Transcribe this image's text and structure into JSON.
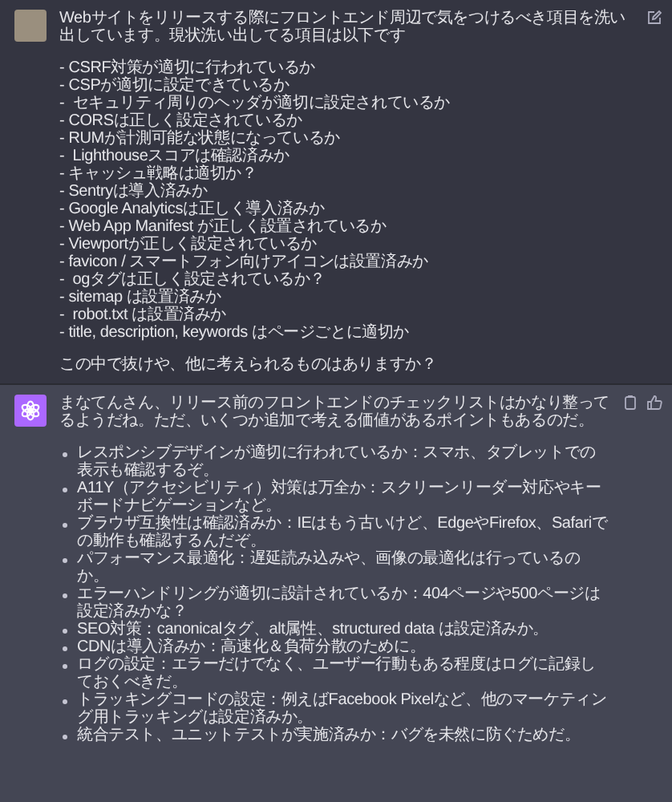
{
  "messages": [
    {
      "kind": "user",
      "text": "Webサイトをリリースする際にフロントエンド周辺で気をつけるべき項目を洗い出しています。現状洗い出してる項目は以下です",
      "list": [
        "- CSRF対策が適切に行われているか",
        "- CSPが適切に設定できているか",
        "-  セキュリティ周りのヘッダが適切に設定されているか",
        "- CORSは正しく設定されているか",
        "- RUMが計測可能な状態になっているか",
        "-  Lighthouseスコアは確認済みか",
        "- キャッシュ戦略は適切か？",
        "- Sentryは導入済みか",
        "- Google Analyticsは正しく導入済みか",
        "- Web App Manifest が正しく設置されているか",
        "- Viewportが正しく設定されているか",
        "- favicon / スマートフォン向けアイコンは設置済みか",
        "-  ogタグは正しく設定されているか？",
        "- sitemap は設置済みか",
        "-  robot.txt は設置済みか",
        "- title, description, keywords はページごとに適切か"
      ],
      "outro": "この中で抜けや、他に考えられるものはありますか？"
    },
    {
      "kind": "assistant",
      "text": "まなてんさん、リリース前のフロントエンドのチェックリストはかなり整ってるようだね。ただ、いくつか追加で考える価値があるポイントもあるのだ。",
      "list": [
        "レスポンシブデザインが適切に行われているか：スマホ、タブレットでの表示も確認するぞ。",
        "A11Y（アクセシビリティ）対策は万全か：スクリーンリーダー対応やキーボードナビゲーションなど。",
        "ブラウザ互換性は確認済みか：IEはもう古いけど、EdgeやFirefox、Safariでの動作も確認するんだぞ。",
        "パフォーマンス最適化：遅延読み込みや、画像の最適化は行っているのか。",
        "エラーハンドリングが適切に設計されているか：404ページや500ページは設定済みかな？",
        "SEO対策：canonicalタグ、alt属性、structured data は設定済みか。",
        "CDNは導入済みか：高速化＆負荷分散のために。",
        "ログの設定：エラーだけでなく、ユーザー行動もある程度はログに記録しておくべきだ。",
        "トラッキングコードの設定：例えばFacebook Pixelなど、他のマーケティング用トラッキングは設定済みか。",
        "統合テスト、ユニットテストが実施済みか：バグを未然に防ぐためだ。"
      ]
    }
  ]
}
